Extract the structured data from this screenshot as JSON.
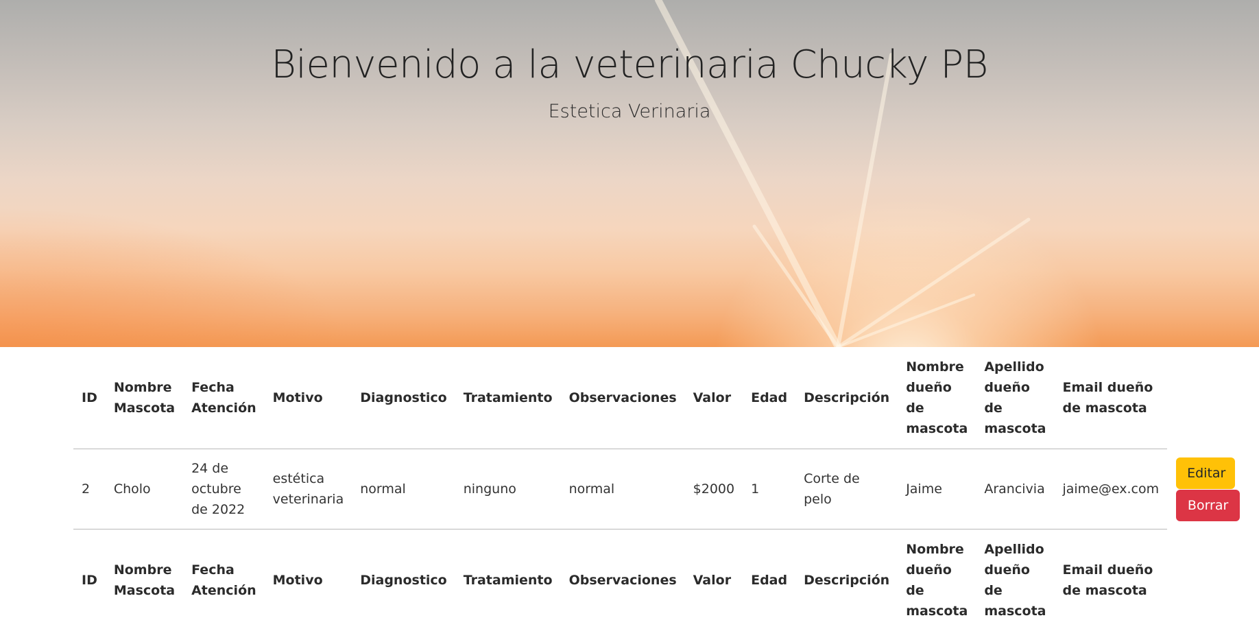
{
  "hero": {
    "title": "Bienvenido a la veterinaria Chucky PB",
    "subtitle": "Estetica Verinaria"
  },
  "table": {
    "headers": [
      "ID",
      "Nombre Mascota",
      "Fecha Atención",
      "Motivo",
      "Diagnostico",
      "Tratamiento",
      "Observaciones",
      "Valor",
      "Edad",
      "Descripción",
      "Nombre dueño de mascota",
      "Apellido dueño de mascota",
      "Email dueño de mascota"
    ],
    "rows": [
      {
        "id": "2",
        "nombre_mascota": "Cholo",
        "fecha": "24 de octubre de 2022",
        "motivo": "estética veterinaria",
        "diagnostico": "normal",
        "tratamiento": "ninguno",
        "observaciones": "normal",
        "valor": "$2000",
        "edad": "1",
        "descripcion": "Corte de pelo",
        "nombre_dueno": "Jaime",
        "apellido_dueno": "Arancivia",
        "email_dueno": "jaime@ex.com",
        "edit_label": "Editar",
        "delete_label": "Borrar"
      }
    ]
  },
  "colors": {
    "edit_button": "#ffc107",
    "delete_button": "#dc3545",
    "hero_top": "#aeaeac",
    "hero_bottom": "#f49a55"
  }
}
